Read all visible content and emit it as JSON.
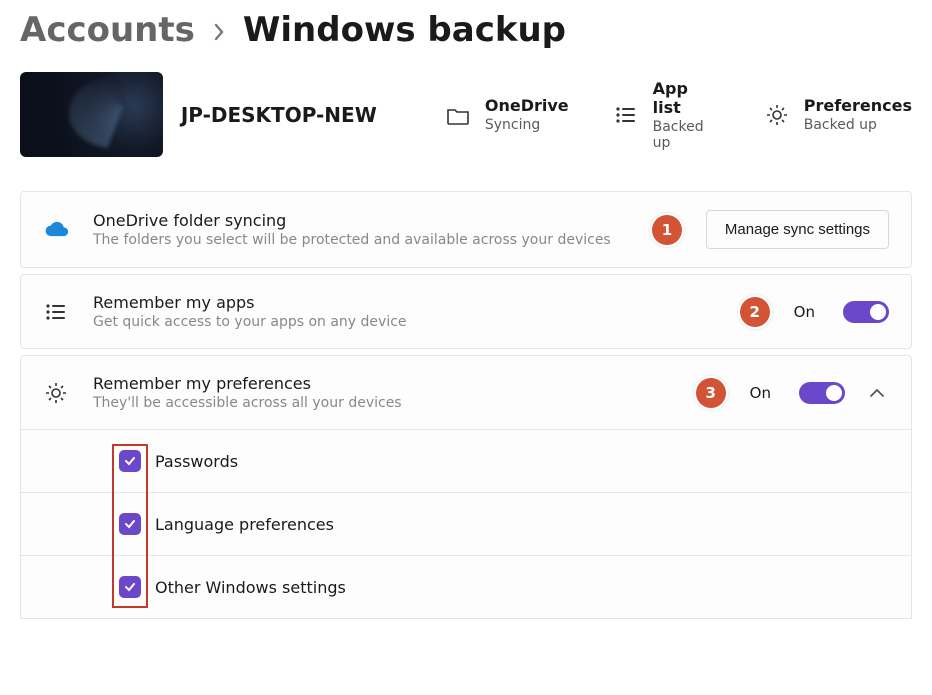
{
  "breadcrumb": {
    "parent": "Accounts",
    "current": "Windows backup"
  },
  "device": {
    "name": "JP-DESKTOP-NEW"
  },
  "stats": {
    "onedrive": {
      "label": "OneDrive",
      "status": "Syncing"
    },
    "applist": {
      "label": "App list",
      "status": "Backed up"
    },
    "prefs": {
      "label": "Preferences",
      "status": "Backed up"
    }
  },
  "cards": {
    "onedrive": {
      "title": "OneDrive folder syncing",
      "desc": "The folders you select will be protected and available across your devices",
      "button": "Manage sync settings"
    },
    "apps": {
      "title": "Remember my apps",
      "desc": "Get quick access to your apps on any device",
      "state": "On"
    },
    "prefs": {
      "title": "Remember my preferences",
      "desc": "They'll be accessible across all your devices",
      "state": "On",
      "items": [
        {
          "label": "Passwords"
        },
        {
          "label": "Language preferences"
        },
        {
          "label": "Other Windows settings"
        }
      ]
    }
  },
  "annotations": [
    "1",
    "2",
    "3"
  ]
}
